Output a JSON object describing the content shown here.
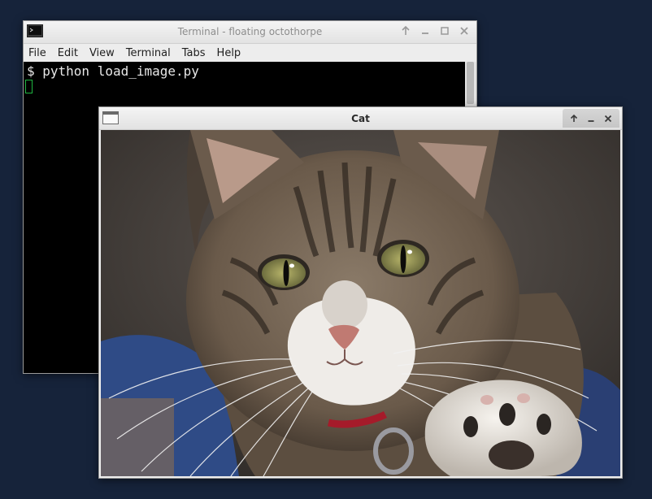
{
  "terminal": {
    "title": "Terminal - floating octothorpe",
    "menu": [
      "File",
      "Edit",
      "View",
      "Terminal",
      "Tabs",
      "Help"
    ],
    "prompt_line": "$ python load_image.py",
    "controls": [
      "up-icon",
      "minimize-icon",
      "maximize-icon",
      "close-icon"
    ]
  },
  "viewer": {
    "title": "Cat",
    "controls": [
      "up-icon",
      "minimize-icon",
      "close-icon"
    ]
  }
}
